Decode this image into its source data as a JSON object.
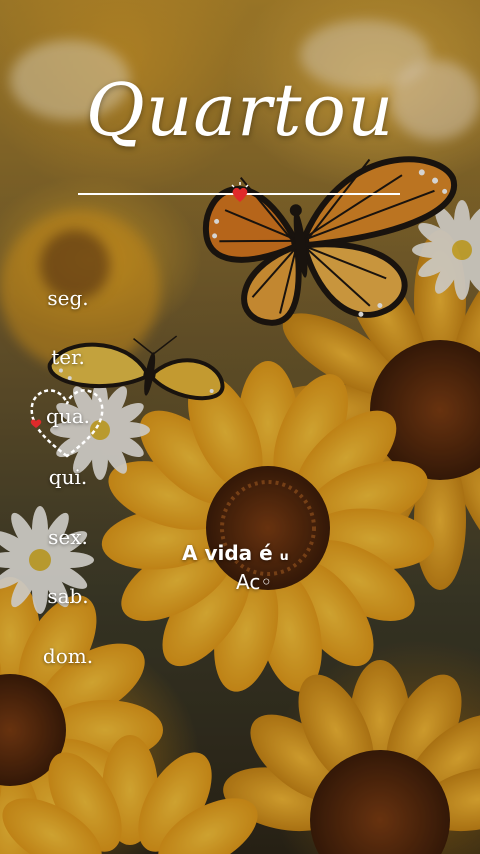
{
  "title": "Quartou",
  "days": [
    "seg.",
    "ter.",
    "qua.",
    "qui.",
    "sex.",
    "sab.",
    "dom."
  ],
  "selected_day": "qua.",
  "quote": {
    "line1": "A vida é ᵤ",
    "line2": "Ac◦"
  },
  "colors": {
    "text": "#ffffff",
    "heart": "#e02a2a",
    "sunflower_petal": "#f2b32a",
    "sunflower_center": "#5a2e12",
    "butterfly_orange": "#d9781f",
    "butterfly_black": "#1a1410"
  },
  "icons": [
    "heart-icon",
    "butterfly-icon",
    "sunflower-icon",
    "daisy-icon",
    "heart-selector-icon"
  ]
}
